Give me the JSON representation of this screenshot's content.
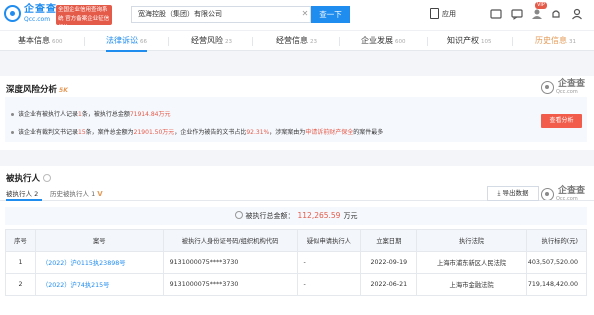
{
  "header": {
    "logo_cn": "企查查",
    "logo_en": "Qcc.com",
    "logo_tag": "全国企业信用查询系统 官方备案企业征信机构",
    "search_value": "宽海控股（集团）有限公司",
    "search_button": "查一下",
    "app_label": "应用",
    "vip_badge": "VIP"
  },
  "tabs": [
    {
      "label": "基本信息",
      "count": "600"
    },
    {
      "label": "法律诉讼",
      "count": "66"
    },
    {
      "label": "经营风险",
      "count": "23"
    },
    {
      "label": "经营信息",
      "count": "23"
    },
    {
      "label": "企业发展",
      "count": "600"
    },
    {
      "label": "知识产权",
      "count": "105"
    },
    {
      "label": "历史信息",
      "count": "31"
    }
  ],
  "risk": {
    "title": "深度风险分析",
    "badge": "5K",
    "line1": {
      "a": "该企业有被执行人记录",
      "b": "1",
      "c": "条，被执行总金额",
      "d": "71914.84万元",
      "e": ""
    },
    "line2": {
      "a": "该企业有裁判文书记录",
      "b": "15",
      "c": "条，案件总金额为",
      "d": "21901.50万元",
      "e": "，企业作为被告的文书占比",
      "f": "92.31%",
      "g": "，涉案案由为",
      "h": "申请诉前财产保全",
      "i": "的案件最多"
    },
    "view_button": "查看分析"
  },
  "watermark": {
    "cn": "企查查",
    "en": "Qcc.com"
  },
  "executed": {
    "title": "被执行人",
    "subtab_active": "被执行人 2",
    "subtab_history": "历史被执行人 1",
    "vip_mark": "V",
    "export_button": "导出数据",
    "total_label": "被执行总金额：",
    "total_amount": "112,265.59",
    "total_unit": "万元",
    "columns": [
      "序号",
      "案号",
      "被执行人身份证号码/组织机构代码",
      "疑似申请执行人",
      "立案日期",
      "执行法院",
      "执行标的(元)"
    ],
    "rows": [
      {
        "no": "1",
        "case": "（2022）沪0115执23898号",
        "id": "9131000075****3730",
        "applicant": "-",
        "date": "2022-09-19",
        "court": "上海市浦东新区人民法院",
        "amount": "403,507,520.00"
      },
      {
        "no": "2",
        "case": "（2022）沪74执215号",
        "id": "9131000075****3730",
        "applicant": "-",
        "date": "2022-06-21",
        "court": "上海市金融法院",
        "amount": "719,148,420.00"
      }
    ]
  }
}
